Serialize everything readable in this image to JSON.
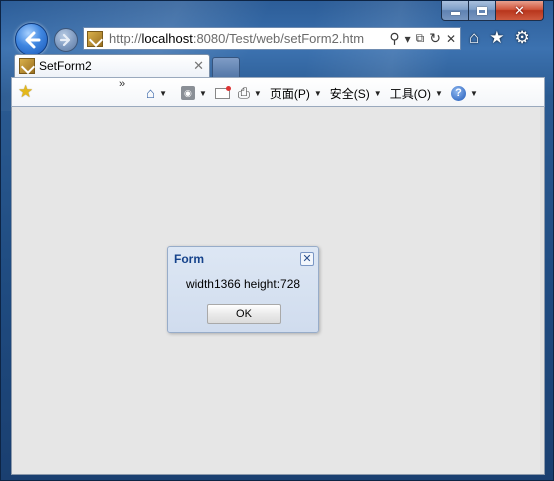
{
  "browser": {
    "url_prefix": "http://",
    "url_host": "localhost",
    "url_rest": ":8080/Test/web/setForm2.htm",
    "addr_icons": {
      "search": "⚲",
      "dropdown": "▾",
      "compat": "⧉",
      "refresh": "↻",
      "stop": "✕"
    }
  },
  "tabs": [
    {
      "title": "SetForm2",
      "close": "✕"
    }
  ],
  "commandbar": {
    "chevrons": "»",
    "page_label": "页面(P)",
    "safety_label": "安全(S)",
    "tools_label": "工具(O)"
  },
  "dialog": {
    "title": "Form",
    "message": "width1366 height:728",
    "ok_label": "OK",
    "close_glyph": "✕"
  },
  "colors": {
    "dialog_title": "#15428b",
    "content_bg": "#e6e6e6",
    "frame": "#2a5a91"
  }
}
